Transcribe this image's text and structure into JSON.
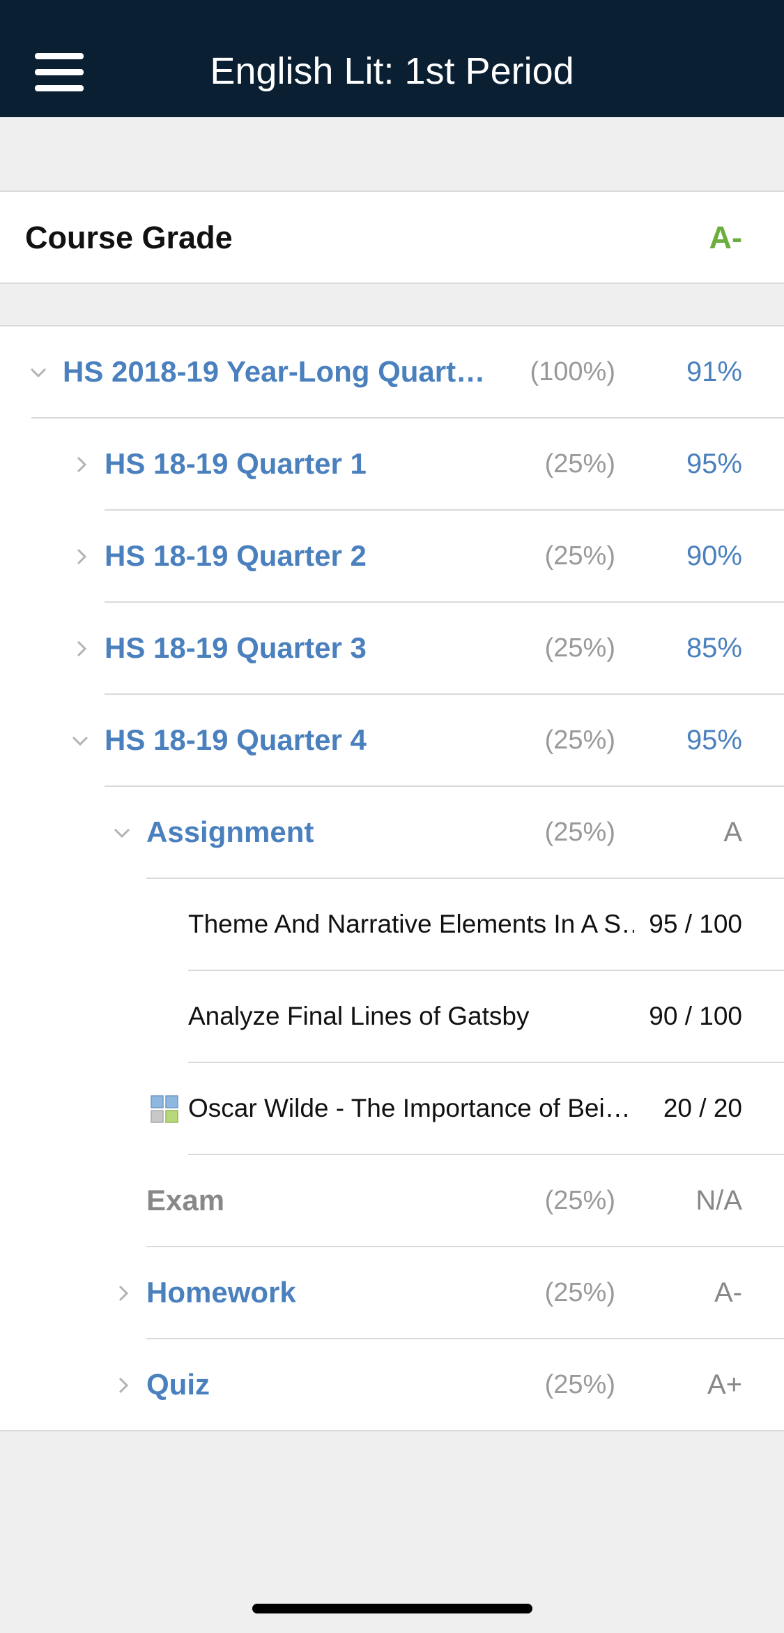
{
  "header": {
    "title": "English Lit: 1st Period",
    "menu_icon": "hamburger-menu-icon"
  },
  "course_grade": {
    "label": "Course Grade",
    "value": "A-",
    "value_color": "#6cae3e"
  },
  "colors": {
    "header_bg": "#0b1f33",
    "link_blue": "#4a80bd",
    "muted_gray": "#888888"
  },
  "rows": [
    {
      "label": "HS 2018-19 Year-Long Quart…",
      "weight": "(100%)",
      "grade": "91%",
      "icon": "chevron-down-icon"
    },
    {
      "label": "HS 18-19 Quarter 1",
      "weight": "(25%)",
      "grade": "95%",
      "icon": "chevron-right-icon"
    },
    {
      "label": "HS 18-19 Quarter 2",
      "weight": "(25%)",
      "grade": "90%",
      "icon": "chevron-right-icon"
    },
    {
      "label": "HS 18-19 Quarter 3",
      "weight": "(25%)",
      "grade": "85%",
      "icon": "chevron-right-icon"
    },
    {
      "label": "HS 18-19 Quarter 4",
      "weight": "(25%)",
      "grade": "95%",
      "icon": "chevron-down-icon"
    },
    {
      "label": "Assignment",
      "weight": "(25%)",
      "grade": "A",
      "icon": "chevron-down-icon"
    },
    {
      "label": "Theme And Narrative Elements In A S…",
      "grade": "95 / 100"
    },
    {
      "label": "Analyze Final Lines of Gatsby",
      "grade": "90 / 100"
    },
    {
      "label": "Oscar Wilde - The Importance of Bei…",
      "grade": "20 / 20",
      "icon": "document-grid-icon"
    },
    {
      "label": "Exam",
      "weight": "(25%)",
      "grade": "N/A"
    },
    {
      "label": "Homework",
      "weight": "(25%)",
      "grade": "A-",
      "icon": "chevron-right-icon"
    },
    {
      "label": "Quiz",
      "weight": "(25%)",
      "grade": "A+",
      "icon": "chevron-right-icon"
    }
  ]
}
